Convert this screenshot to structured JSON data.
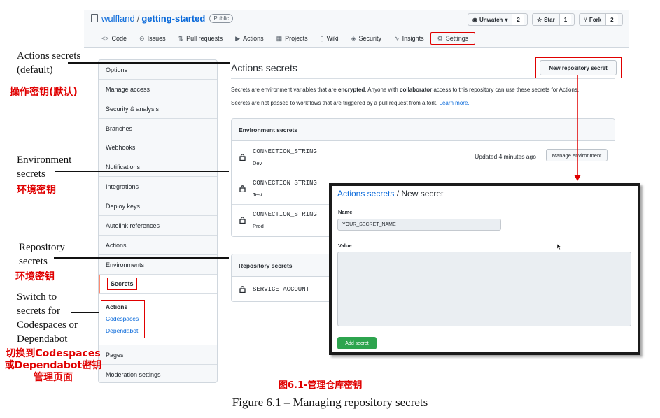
{
  "repo": {
    "owner": "wulfland",
    "name": "getting-started",
    "visibility": "Public"
  },
  "header_buttons": [
    {
      "label": "Unwatch",
      "count": "2",
      "icon": "eye-icon",
      "caret": "▾"
    },
    {
      "label": "Star",
      "count": "1",
      "icon": "star-icon"
    },
    {
      "label": "Fork",
      "count": "2",
      "icon": "fork-icon"
    }
  ],
  "tabs": [
    {
      "label": "Code",
      "icon": "code-icon",
      "glyph": "<>"
    },
    {
      "label": "Issues",
      "icon": "issue-icon",
      "glyph": "⊙"
    },
    {
      "label": "Pull requests",
      "icon": "pull-request-icon",
      "glyph": "⇅"
    },
    {
      "label": "Actions",
      "icon": "play-icon",
      "glyph": "▶"
    },
    {
      "label": "Projects",
      "icon": "project-icon",
      "glyph": "▦"
    },
    {
      "label": "Wiki",
      "icon": "book-icon",
      "glyph": "▯"
    },
    {
      "label": "Security",
      "icon": "shield-icon",
      "glyph": "◈"
    },
    {
      "label": "Insights",
      "icon": "graph-icon",
      "glyph": "∿"
    },
    {
      "label": "Settings",
      "icon": "gear-icon",
      "glyph": "⚙",
      "selected": true
    }
  ],
  "sidebar": {
    "items": [
      "Options",
      "Manage access",
      "Security & analysis",
      "Branches",
      "Webhooks",
      "Notifications",
      "Integrations",
      "Deploy keys",
      "Autolink references",
      "Actions",
      "Environments",
      "Secrets"
    ],
    "secrets_submenu": [
      "Actions",
      "Codespaces",
      "Dependabot"
    ],
    "bottom_items": [
      "Pages",
      "Moderation settings"
    ]
  },
  "main": {
    "title": "Actions secrets",
    "new_secret_button": "New repository secret",
    "desc1_a": "Secrets are environment variables that are ",
    "desc1_b": "encrypted",
    "desc1_c": ". Anyone with ",
    "desc1_d": "collaborator",
    "desc1_e": " access to this repository can use these secrets for Actions.",
    "desc2": "Secrets are not passed to workflows that are triggered by a pull request from a fork.",
    "desc2_link": "Learn more.",
    "environment_secrets": {
      "heading": "Environment secrets",
      "rows": [
        {
          "name": "CONNECTION_STRING",
          "env": "Dev",
          "updated": "Updated 4 minutes ago",
          "button": "Manage environment"
        },
        {
          "name": "CONNECTION_STRING",
          "env": "Test"
        },
        {
          "name": "CONNECTION_STRING",
          "env": "Prod"
        }
      ]
    },
    "repository_secrets": {
      "heading": "Repository secrets",
      "rows": [
        {
          "name": "SERVICE_ACCOUNT"
        }
      ]
    }
  },
  "popup": {
    "title_link": "Actions secrets",
    "title_rest": " / New secret",
    "name_label": "Name",
    "name_value": "YOUR_SECRET_NAME",
    "value_label": "Value",
    "value_value": "",
    "submit": "Add secret"
  },
  "annotations": {
    "actions_secrets_en": [
      "Actions secrets",
      "(default)"
    ],
    "actions_secrets_cn": "操作密钥(默认)",
    "environment_en": [
      "Environment",
      "secrets"
    ],
    "environment_cn": "环境密钥",
    "repository_en": [
      "Repository",
      "secrets"
    ],
    "repository_cn": "环境密钥",
    "switch_en": [
      "Switch to",
      "secrets for",
      "Codespaces or",
      "Dependabot"
    ],
    "switch_cn": [
      "切换到Codespaces",
      "或Dependabot密钥",
      "管理页面"
    ]
  },
  "captions": {
    "cn": "图6.1-管理仓库密钥",
    "en": "Figure 6.1 – Managing repository secrets"
  },
  "colors": {
    "highlight_red": "#e00000",
    "link_blue": "#0969da",
    "add_button_green": "#2da44e"
  }
}
